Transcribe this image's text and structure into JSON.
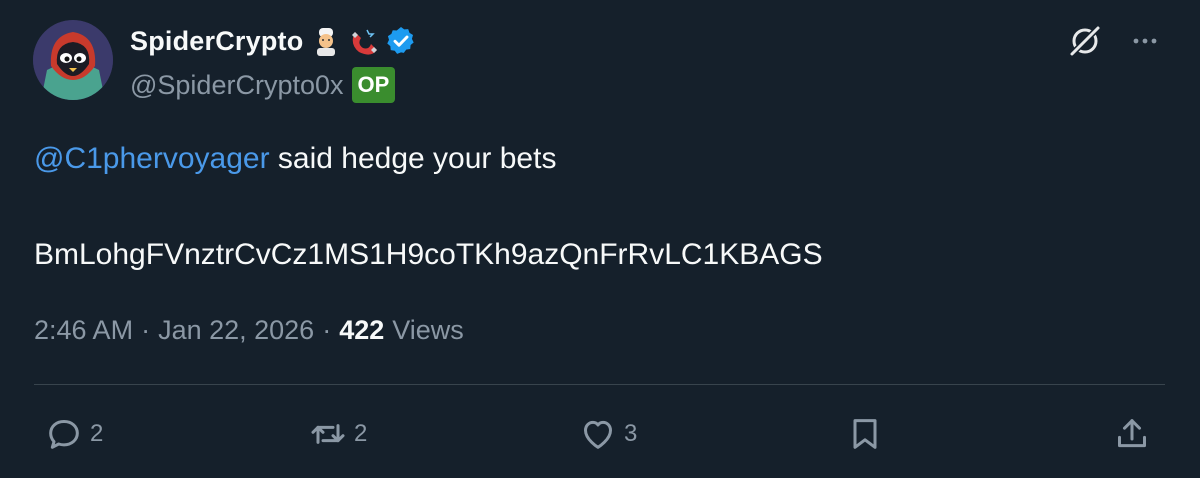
{
  "author": {
    "display_name": "SpiderCrypto",
    "handle": "@SpiderCrypto0x",
    "badge": "OP",
    "emojis": [
      "cook-emoji",
      "magnet-emoji"
    ],
    "verified": true
  },
  "tweet": {
    "mention": "@C1phervoyager",
    "text_rest": " said hedge your bets",
    "code": "BmLohgFVnztrCvCz1MS1H9coTKh9azQnFrRvLC1KBAGS"
  },
  "meta": {
    "time": "2:46 AM",
    "sep1": "·",
    "date": "Jan 22, 2026",
    "sep2": "·",
    "views_count": "422",
    "views_label": "Views"
  },
  "actions": {
    "replies": "2",
    "reposts": "2",
    "likes": "3"
  },
  "colors": {
    "background": "#15202b",
    "accent": "#4a99e9",
    "muted": "#8b98a5",
    "op_badge": "#3a8d2e",
    "verified": "#1d9bf0"
  },
  "icons": [
    "grok-icon",
    "more-icon",
    "reply-icon",
    "retweet-icon",
    "like-icon",
    "bookmark-icon",
    "share-icon"
  ]
}
